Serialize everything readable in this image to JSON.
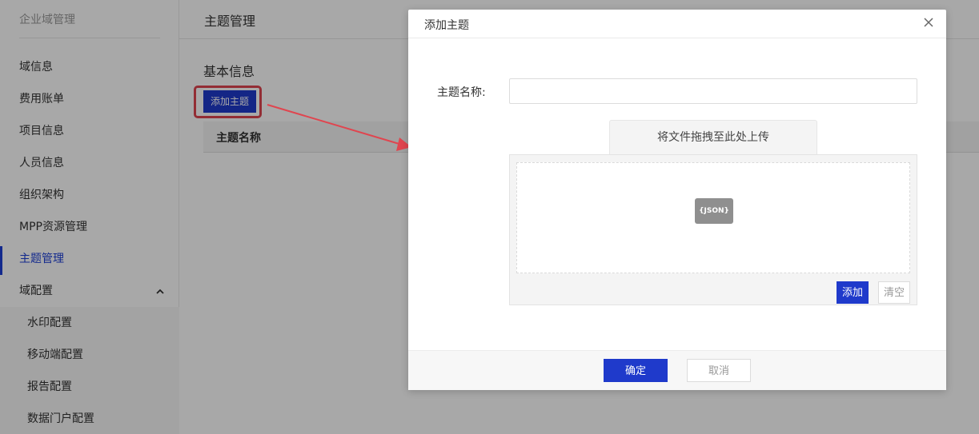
{
  "sidebar": {
    "brand": "企业域管理",
    "items": [
      {
        "label": "域信息"
      },
      {
        "label": "费用账单"
      },
      {
        "label": "项目信息"
      },
      {
        "label": "人员信息"
      },
      {
        "label": "组织架构"
      },
      {
        "label": "MPP资源管理"
      },
      {
        "label": "主题管理",
        "active": true
      },
      {
        "label": "域配置",
        "expanded": true
      }
    ],
    "sub_items": [
      {
        "label": "水印配置"
      },
      {
        "label": "移动端配置"
      },
      {
        "label": "报告配置"
      },
      {
        "label": "数据门户配置"
      }
    ]
  },
  "main": {
    "header_title": "主题管理",
    "section_title": "基本信息",
    "add_button_label": "添加主题",
    "table_columns": [
      "主题名称"
    ]
  },
  "modal": {
    "title": "添加主题",
    "name_label": "主题名称:",
    "name_value": "",
    "upload_tab_label": "将文件拖拽至此处上传",
    "file_icon": "json-file-icon",
    "file_icon_text": "{JSON}",
    "add_label": "添加",
    "clear_label": "清空",
    "ok_label": "确定",
    "cancel_label": "取消"
  },
  "colors": {
    "primary": "#1f3acb",
    "active_nav": "#1d3fd6",
    "highlight": "#e0454f"
  }
}
